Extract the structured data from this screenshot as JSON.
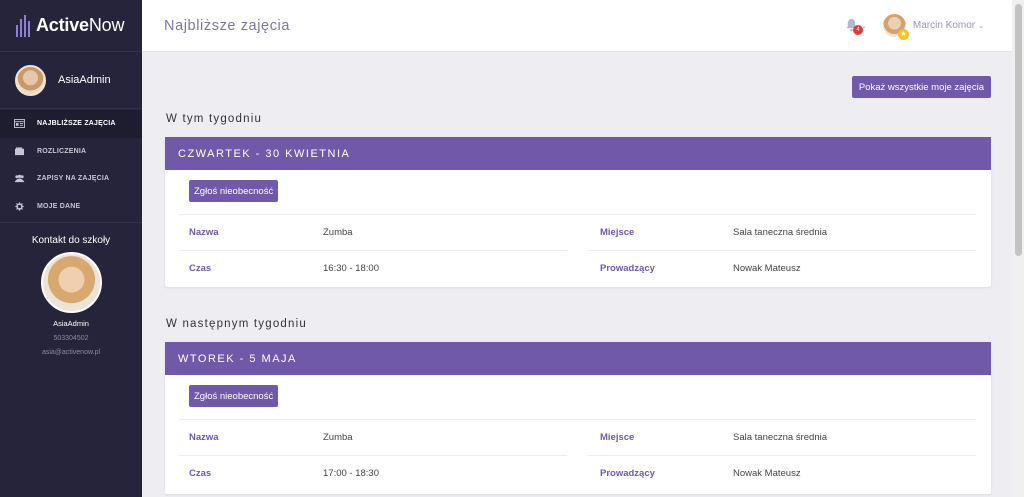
{
  "app": {
    "brand_bold": "Active",
    "brand_thin": "Now"
  },
  "sidebar": {
    "user_name": "AsiaAdmin",
    "nav": [
      {
        "label": "NAJBLIŻSZE ZAJĘCIA",
        "icon": "calendar-icon"
      },
      {
        "label": "ROZLICZENIA",
        "icon": "wallet-icon"
      },
      {
        "label": "ZAPISY NA ZAJĘCIA",
        "icon": "users-icon"
      },
      {
        "label": "MOJE DANE",
        "icon": "gear-icon"
      }
    ],
    "contact": {
      "title": "Kontakt do szkoły",
      "name": "AsiaAdmin",
      "phone": "503304502",
      "email": "asia@activenow.pl"
    }
  },
  "header": {
    "title": "Najbliższe zajęcia",
    "notification_count": "4",
    "user_name": "Marcin Komor"
  },
  "main": {
    "show_all_button": "Pokaż wszystkie moje zajęcia",
    "sections": [
      {
        "title": "W tym tygodniu",
        "day": "CZWARTEK - 30 KWIETNIA",
        "absence_button": "Zgłoś nieobecność",
        "labels": {
          "name": "Nazwa",
          "time": "Czas",
          "place": "Miejsce",
          "instructor": "Prowadzący"
        },
        "values": {
          "name": "Zumba",
          "time": "16:30 - 18:00",
          "place": "Sala taneczna średnia",
          "instructor": "Nowak Mateusz"
        }
      },
      {
        "title": "W następnym tygodniu",
        "day": "WTOREK - 5 MAJA",
        "absence_button": "Zgłoś nieobecność",
        "labels": {
          "name": "Nazwa",
          "time": "Czas",
          "place": "Miejsce",
          "instructor": "Prowadzący"
        },
        "values": {
          "name": "Zumba",
          "time": "17:00 - 18:30",
          "place": "Sala taneczna średnia",
          "instructor": "Nowak Mateusz"
        }
      }
    ]
  },
  "colors": {
    "accent": "#7159aa",
    "sidebar": "#26243a",
    "badge": "#e23a3a"
  }
}
